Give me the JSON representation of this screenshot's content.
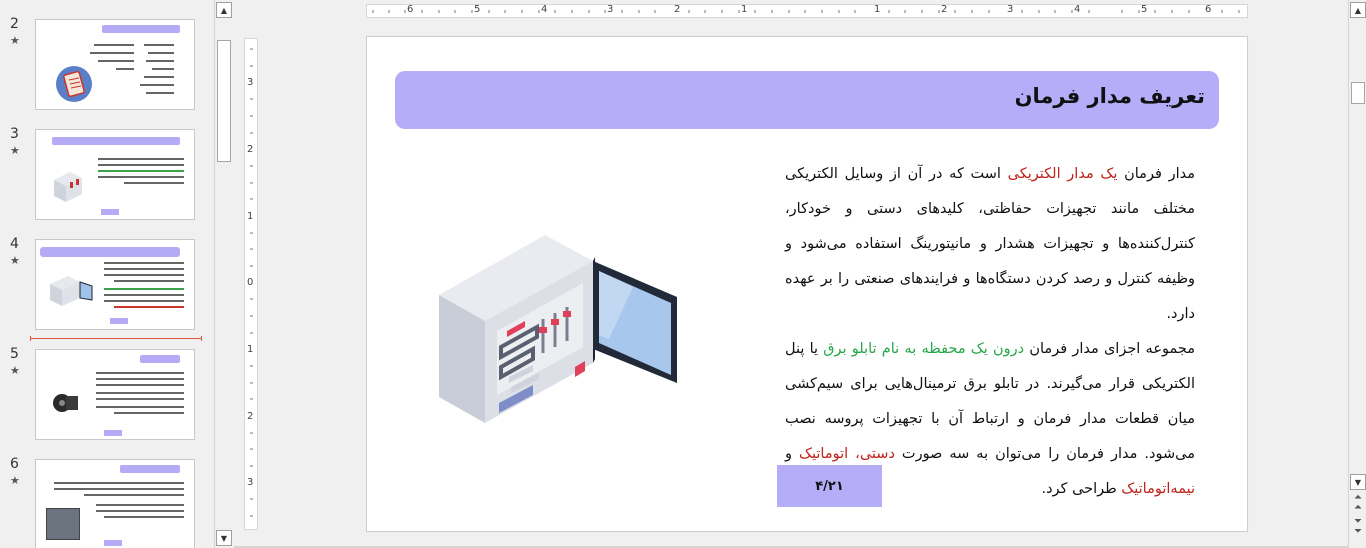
{
  "thumbnails": [
    {
      "number": "2",
      "star": "★"
    },
    {
      "number": "3",
      "star": "★"
    },
    {
      "number": "4",
      "star": "★"
    },
    {
      "number": "5",
      "star": "★"
    },
    {
      "number": "6",
      "star": "★"
    }
  ],
  "ruler": {
    "h_labels": [
      "6",
      "5",
      "4",
      "3",
      "2",
      "1",
      "",
      "1",
      "2",
      "3",
      "4",
      "5",
      "6"
    ],
    "v_labels": [
      "3",
      "2",
      "1",
      "0",
      "1",
      "2",
      "3"
    ]
  },
  "slide": {
    "title": "تعریف مدار فرمان",
    "p1_a": "مدار فرمان ",
    "p1_red": "یک مدار الکتریکی",
    "p1_b": " است که در آن از وسایل الکتریکی مختلف مانند تجهیزات حفاظتی، کلیدهای دستی و خودکار، کنترل‌کننده‌ها و تجهیزات هشدار و مانیتورینگ استفاده می‌شود و وظیفه کنترل و رصد کردن دستگاه‌ها و فرایندهای صنعتی را بر عهده دارد.",
    "p2_a": "مجموعه اجزای مدار فرمان ",
    "p2_green": "درون یک محفظه به نام تابلو برق",
    "p2_b": " یا پنل الکتریکی قرار می‌گیرند. در تابلو برق ترمینال‌هایی برای سیم‌کشی میان قطعات مدار فرمان و ارتباط آن با تجهیزات پروسه نصب می‌شود. مدار فرمان را می‌توان به سه صورت ",
    "p2_red1": "دستی، اتوماتیک",
    "p2_c": " و ",
    "p2_red2": "نیمه‌اتوماتیک",
    "p2_d": " طراحی کرد.",
    "page_number": "۴/۲۱"
  },
  "colors": {
    "accent": "#b6adf8",
    "red_text": "#c0221c",
    "green_text": "#27a64a"
  }
}
